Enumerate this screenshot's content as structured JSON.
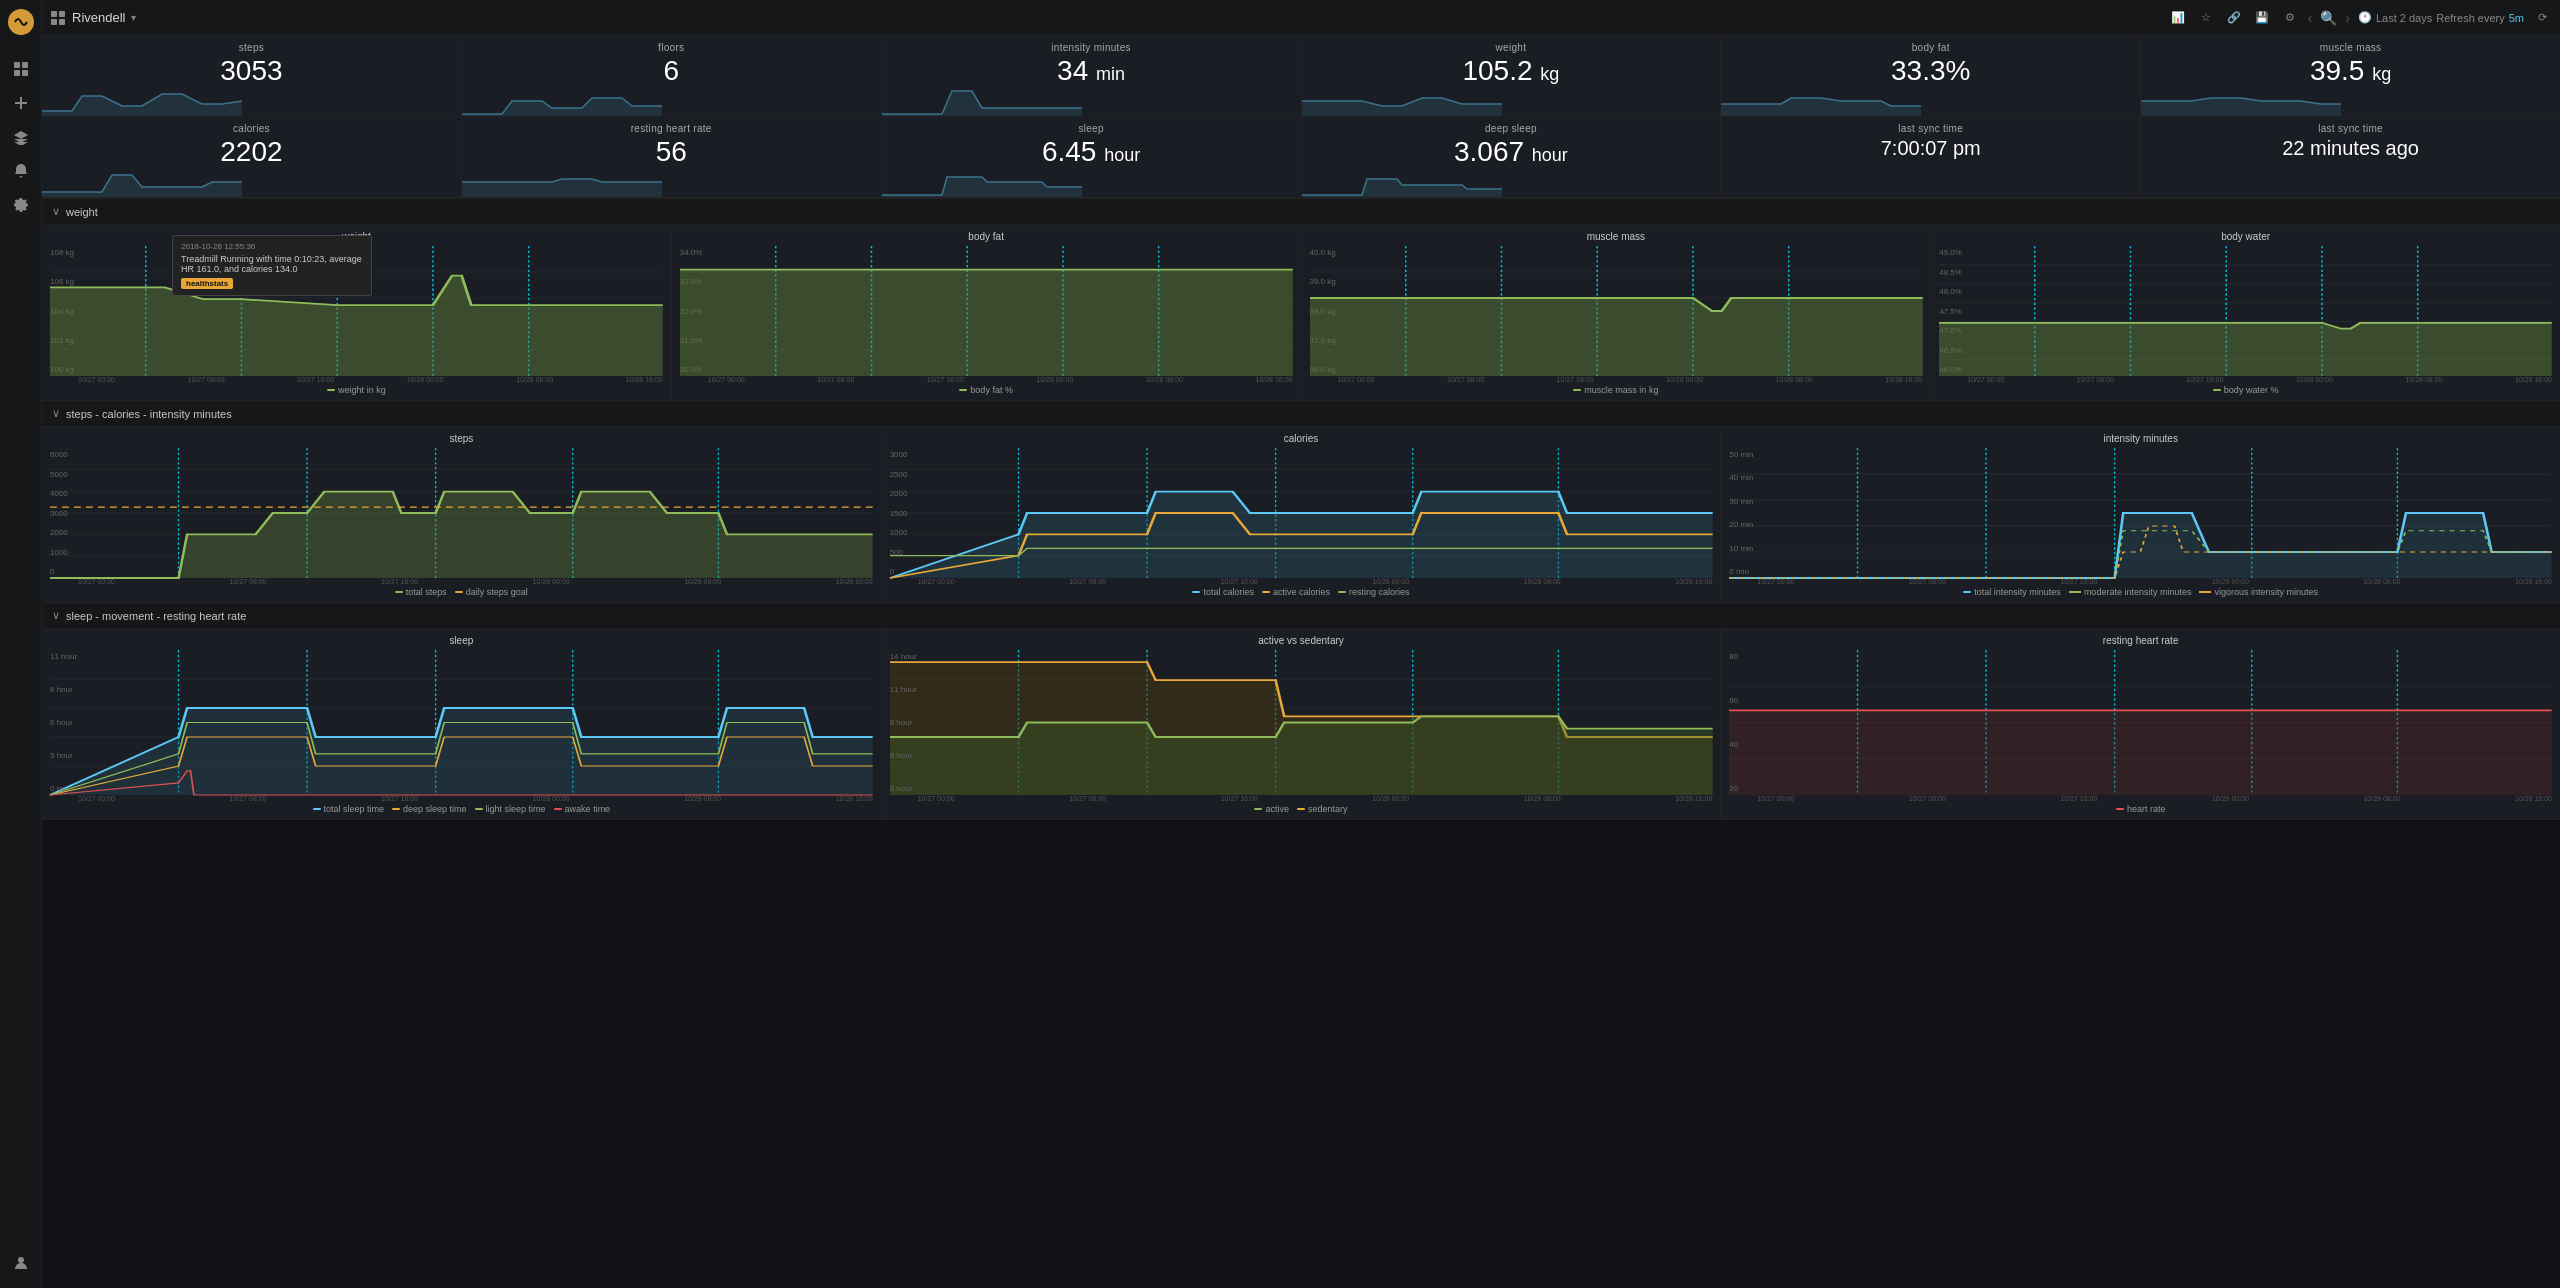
{
  "app": {
    "title": "Rivendell",
    "chevron": "▾"
  },
  "topbar": {
    "last_period": "Last 2 days",
    "refresh_label": "Refresh every",
    "refresh_value": "5m",
    "refresh_icon": "⟳"
  },
  "stat_row1": [
    {
      "label": "steps",
      "value": "3053",
      "unit": ""
    },
    {
      "label": "floors",
      "value": "6",
      "unit": ""
    },
    {
      "label": "intensity minutes",
      "value": "34",
      "unit": "min"
    },
    {
      "label": "weight",
      "value": "105.2",
      "unit": "kg"
    },
    {
      "label": "body fat",
      "value": "33.3%",
      "unit": ""
    },
    {
      "label": "muscle mass",
      "value": "39.5",
      "unit": "kg"
    }
  ],
  "stat_row2": [
    {
      "label": "calories",
      "value": "2202",
      "unit": ""
    },
    {
      "label": "resting heart rate",
      "value": "56",
      "unit": ""
    },
    {
      "label": "sleep",
      "value": "6.45",
      "unit": "hour"
    },
    {
      "label": "deep sleep",
      "value": "3.067",
      "unit": "hour"
    },
    {
      "label": "last sync time",
      "value": "7:00:07 pm",
      "unit": ""
    },
    {
      "label": "last sync time",
      "value": "22 minutes ago",
      "unit": ""
    }
  ],
  "sections": {
    "weight": {
      "title": "weight",
      "charts": [
        {
          "title": "weight",
          "y_labels": [
            "108 kg",
            "106 kg",
            "104 kg",
            "102 kg",
            "100 kg"
          ],
          "legend": [
            {
              "label": "weight in kg",
              "color": "#8fbc5a",
              "dash": false
            }
          ]
        },
        {
          "title": "body fat",
          "y_labels": [
            "34.0%",
            "33.0%",
            "32.0%",
            "31.0%",
            "30.0%"
          ],
          "legend": [
            {
              "label": "body fat %",
              "color": "#8fbc5a",
              "dash": false
            }
          ]
        },
        {
          "title": "muscle mass",
          "y_labels": [
            "40.0 kg",
            "39.0 kg",
            "38.0 kg",
            "37.0 kg",
            "36.0 kg"
          ],
          "legend": [
            {
              "label": "muscle mass in kg",
              "color": "#8fbc5a",
              "dash": false
            }
          ]
        },
        {
          "title": "body water",
          "y_labels": [
            "49.0%",
            "48.5%",
            "48.0%",
            "47.0%",
            "46.5%",
            "46.0%"
          ],
          "legend": [
            {
              "label": "body water %",
              "color": "#8fbc5a",
              "dash": false
            }
          ]
        }
      ],
      "x_labels": [
        "10/27 00:00",
        "10/27 08:00",
        "10/27 16:00",
        "10/28 00:00",
        "10/28 08:00",
        "10/28 16:00"
      ]
    },
    "steps": {
      "title": "steps - calories - intensity minutes",
      "charts": [
        {
          "title": "steps",
          "y_labels": [
            "6000",
            "5000",
            "4000",
            "3000",
            "2000",
            "1000",
            "0"
          ],
          "legend": [
            {
              "label": "total steps",
              "color": "#8fbc5a",
              "dash": false
            },
            {
              "label": "daily steps goal",
              "color": "#e8a838",
              "dash": true
            }
          ]
        },
        {
          "title": "calories",
          "y_labels": [
            "3000",
            "2500",
            "2000",
            "1500",
            "1000",
            "500",
            "0"
          ],
          "legend": [
            {
              "label": "total calories",
              "color": "#5bc8f5",
              "dash": false
            },
            {
              "label": "active calories",
              "color": "#e8a838",
              "dash": false
            },
            {
              "label": "resting calories",
              "color": "#8fbc5a",
              "dash": false
            }
          ]
        },
        {
          "title": "intensity minutes",
          "y_labels": [
            "50 min",
            "40 min",
            "30 min",
            "20 min",
            "10 min",
            "0 min"
          ],
          "legend": [
            {
              "label": "total intensity minutes",
              "color": "#5bc8f5",
              "dash": false
            },
            {
              "label": "moderate intensity minutes",
              "color": "#8fbc5a",
              "dash": true
            },
            {
              "label": "vigorous intensity minutes",
              "color": "#e8a838",
              "dash": true
            }
          ]
        }
      ],
      "x_labels": [
        "10/27 00:00",
        "10/27 08:00",
        "10/27 16:00",
        "10/28 00:00",
        "10/28 08:00",
        "10/28 16:00"
      ]
    },
    "sleep": {
      "title": "sleep - movement - resting heart rate",
      "charts": [
        {
          "title": "sleep",
          "y_labels": [
            "11 hour",
            "8 hour",
            "6 hour",
            "3 hour",
            "0 ns"
          ],
          "legend": [
            {
              "label": "total sleep time",
              "color": "#5bc8f5",
              "dash": false
            },
            {
              "label": "deep sleep time",
              "color": "#e8a838",
              "dash": false
            },
            {
              "label": "light sleep time",
              "color": "#8fbc5a",
              "dash": false
            },
            {
              "label": "awake time",
              "color": "#e05050",
              "dash": false
            }
          ]
        },
        {
          "title": "active vs sedentary",
          "y_labels": [
            "14 hour",
            "11 hour",
            "8 hour",
            "6 hour",
            "3 hour"
          ],
          "legend": [
            {
              "label": "active",
              "color": "#8fbc5a",
              "dash": false
            },
            {
              "label": "sedentary",
              "color": "#e8a838",
              "dash": false
            }
          ]
        },
        {
          "title": "resting heart rate",
          "y_labels": [
            "80",
            "60",
            "40",
            "20"
          ],
          "legend": [
            {
              "label": "heart rate",
              "color": "#e05050",
              "dash": false
            }
          ]
        }
      ],
      "x_labels": [
        "10/27 00:00",
        "10/27 08:00",
        "10/27 16:00",
        "10/28 00:00",
        "10/28 08:00",
        "10/28 16:00"
      ]
    }
  },
  "tooltip": {
    "timestamp": "2018-10-28 12:55:36",
    "text": "Treadmill Running with time 0:10:23, average HR 161.0, and calories 134.0",
    "link": "healthstats"
  },
  "sidebar_icons": [
    "grid",
    "plus",
    "layers",
    "bell",
    "gear",
    "user"
  ]
}
